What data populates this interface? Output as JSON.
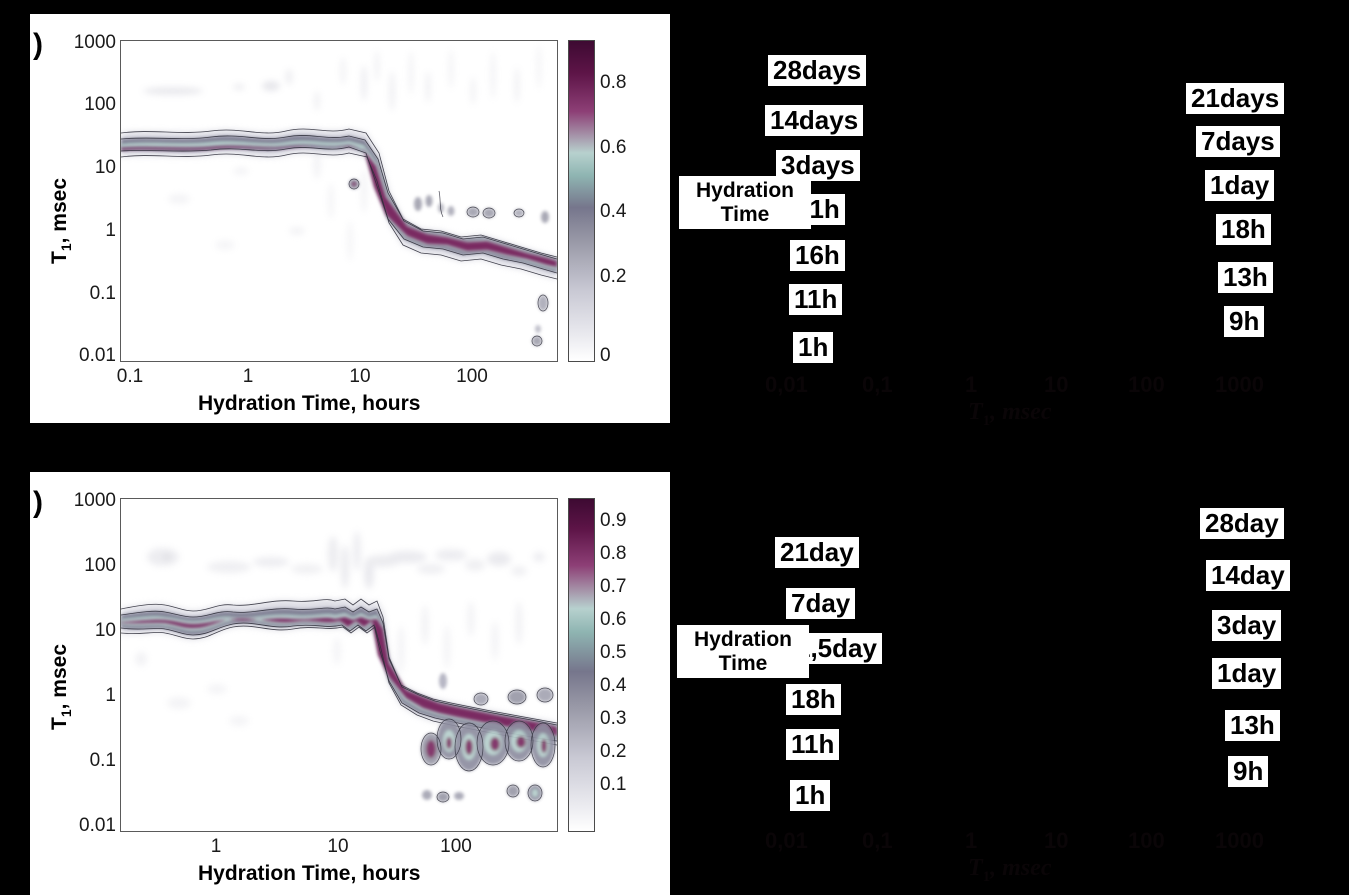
{
  "figure": {
    "background": "#000000",
    "panel_background": "#ffffff"
  },
  "panels": [
    {
      "tag": ")",
      "axis": {
        "xlabel": "Hydration Time, hours",
        "ylabel_main": "T",
        "ylabel_sub": "1",
        "ylabel_rest": ", msec",
        "xticks": [
          "0.1",
          "1",
          "10",
          "100"
        ],
        "yticks": [
          "1000",
          "100",
          "10",
          "1",
          "0.1",
          "0.01"
        ]
      },
      "colorbar": {
        "ticks": [
          "0.8",
          "0.6",
          "0.4",
          "0.2",
          "0"
        ],
        "min": "0",
        "max": "1"
      },
      "left_column_labels": [
        "28days",
        "14days",
        "3days",
        "21h",
        "16h",
        "11h",
        "1h"
      ],
      "right_column_labels": [
        "21days",
        "7days",
        "1day",
        "18h",
        "13h",
        "9h"
      ],
      "hydration_label_line1": "Hydration",
      "hydration_label_line2": "Time",
      "dark_axis": {
        "xticks": [
          "0,01",
          "0,1",
          "1",
          "10",
          "100",
          "1000"
        ],
        "title_main": "T",
        "title_sub": "1",
        "title_rest": ", msec"
      }
    },
    {
      "tag": ")",
      "axis": {
        "xlabel": "Hydration Time, hours",
        "ylabel_main": "T",
        "ylabel_sub": "1",
        "ylabel_rest": ", msec",
        "xticks": [
          "1",
          "10",
          "100"
        ],
        "yticks": [
          "1000",
          "100",
          "10",
          "1",
          "0.1",
          "0.01"
        ]
      },
      "colorbar": {
        "ticks": [
          "0.9",
          "0.8",
          "0.7",
          "0.6",
          "0.5",
          "0.4",
          "0.3",
          "0.2",
          "0.1"
        ],
        "min": "0",
        "max": "1"
      },
      "left_column_labels": [
        "21day",
        "7day",
        "1,5day",
        "18h",
        "11h",
        "1h"
      ],
      "right_column_labels": [
        "28day",
        "14day",
        "3day",
        "1day",
        "13h",
        "9h"
      ],
      "hydration_label_line1": "Hydration",
      "hydration_label_line2": "Time",
      "dark_axis": {
        "xticks": [
          "0,01",
          "0,1",
          "1",
          "10",
          "100",
          "1000"
        ],
        "title_main": "T",
        "title_sub": "1",
        "title_rest": ", msec"
      }
    }
  ],
  "chart_data": [
    {
      "type": "heatmap",
      "title": "",
      "xlabel": "Hydration Time, hours",
      "ylabel": "T1, msec",
      "xscale": "log",
      "yscale": "log",
      "xlim": [
        0.07,
        600
      ],
      "ylim": [
        0.01,
        1000
      ],
      "zlim": [
        0,
        1
      ],
      "colorbar_ticks": [
        0,
        0.2,
        0.4,
        0.6,
        0.8
      ],
      "colormap": [
        "#ffffff",
        "#d7d7dd",
        "#9a9aa8",
        "#6b6b80",
        "#8fb5b2",
        "#a14c86",
        "#6b1a52",
        "#3d0a32"
      ],
      "grid": false,
      "legend": "none",
      "description": "T1 relaxation-time distribution map versus hydration time; intense ridge near T1 = 18 msec up to ~7 h, steep drop between 7 and 20 h, then a lower ridge drifting from ~1 msec down to ~0.4 msec out to 500 h.",
      "ridge_main": {
        "x": [
          0.08,
          0.3,
          1,
          3,
          5,
          7,
          9,
          12,
          16,
          20,
          30,
          50,
          80,
          130,
          200,
          300,
          400,
          500
        ],
        "y": [
          19,
          19,
          19,
          19,
          19,
          20,
          14,
          5,
          1.6,
          1.2,
          1.0,
          0.95,
          0.9,
          0.8,
          0.7,
          0.6,
          0.5,
          0.4
        ],
        "peak_value": [
          0.95,
          0.95,
          0.95,
          0.95,
          0.95,
          0.9,
          0.85,
          0.8,
          0.85,
          0.88,
          0.9,
          0.9,
          0.9,
          0.88,
          0.88,
          0.9,
          0.9,
          0.9
        ]
      }
    },
    {
      "type": "heatmap",
      "title": "",
      "xlabel": "Hydration Time, hours",
      "ylabel": "T1, msec",
      "xscale": "log",
      "yscale": "log",
      "xlim": [
        0.15,
        600
      ],
      "ylim": [
        0.01,
        1000
      ],
      "zlim": [
        0,
        1
      ],
      "colorbar_ticks": [
        0.1,
        0.2,
        0.3,
        0.4,
        0.5,
        0.6,
        0.7,
        0.8,
        0.9
      ],
      "colormap": [
        "#ffffff",
        "#d7d7dd",
        "#9a9aa8",
        "#6b6b80",
        "#8fb5b2",
        "#a14c86",
        "#6b1a52",
        "#3d0a32"
      ],
      "grid": false,
      "legend": "none",
      "description": "T1 relaxation-time distribution map versus hydration time; ridge near T1 = 10 msec persisting to ~25 h, abrupt drop, then scattered low-T1 features between 0.05 and 1 msec from 40 to 500 h.",
      "ridge_main": {
        "x": [
          0.18,
          0.4,
          1,
          3,
          7,
          12,
          20,
          25,
          30,
          40,
          60,
          100,
          150,
          250,
          400,
          500
        ],
        "y": [
          12,
          11,
          9,
          9,
          9,
          9,
          9,
          4,
          1.2,
          1.0,
          0.7,
          0.5,
          0.35,
          0.3,
          0.28,
          0.25
        ],
        "peak_value": [
          0.9,
          0.95,
          0.95,
          0.95,
          0.95,
          0.95,
          0.92,
          0.8,
          0.85,
          0.9,
          0.92,
          0.9,
          0.9,
          0.92,
          0.9,
          0.88
        ]
      }
    }
  ]
}
